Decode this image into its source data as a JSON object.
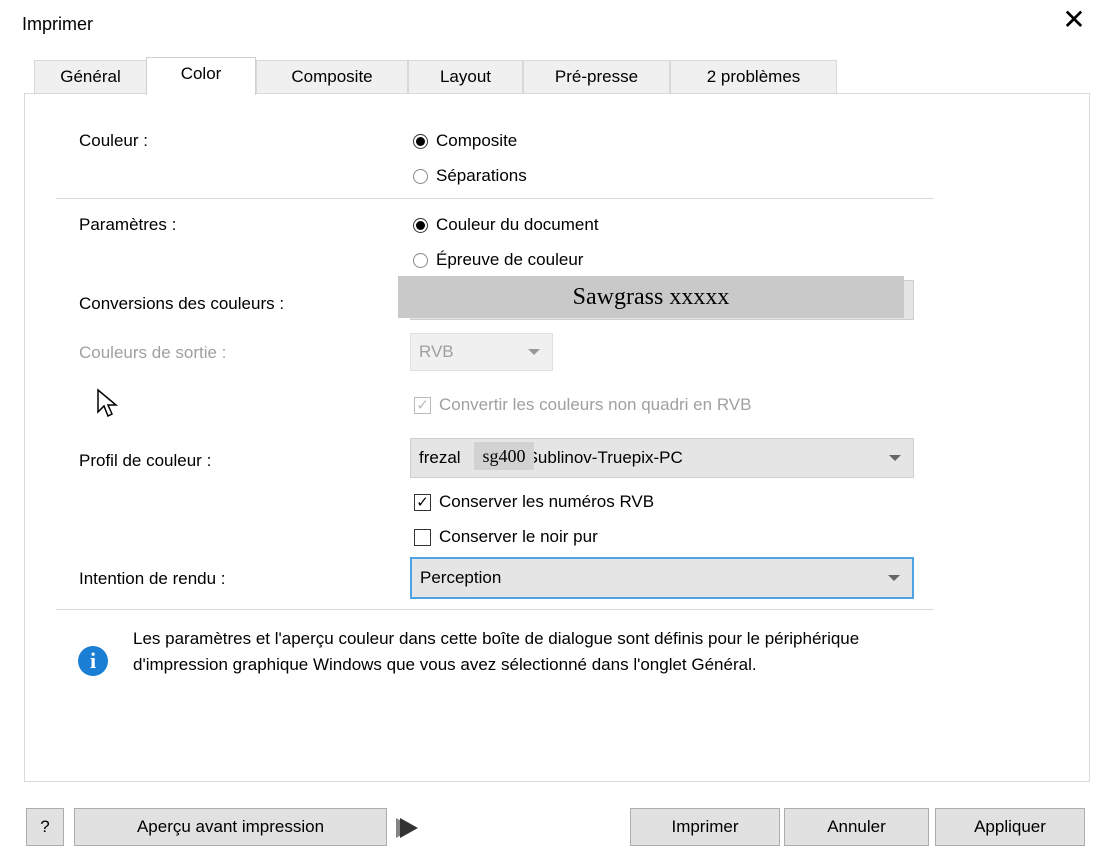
{
  "window": {
    "title": "Imprimer",
    "close_glyph": "✕"
  },
  "tabs": [
    "Général",
    "Color",
    "Composite",
    "Layout",
    "Pré-presse",
    "2 problèmes"
  ],
  "active_tab": "Color",
  "color": {
    "label": "Couleur :",
    "opt1": "Composite",
    "opt2": "Séparations",
    "selected": "Composite"
  },
  "params": {
    "label": "Paramètres :",
    "opt1": "Couleur du document",
    "opt2": "Épreuve de couleur",
    "selected": "Couleur du document"
  },
  "conversions": {
    "label": "Conversions des couleurs :",
    "overlay_text": "Sawgrass xxxxx"
  },
  "output_colors": {
    "label": "Couleurs de sortie :",
    "value": "RVB"
  },
  "convert_non_quadri": {
    "label": "Convertir les couleurs non quadri en RVB",
    "checked": true
  },
  "profile": {
    "label": "Profil de couleur :",
    "prefix": "frezal",
    "overlay_text": "sg400",
    "suffix": "Sublinov-Truepix-PC"
  },
  "keep_rgb": {
    "label": "Conserver les numéros RVB",
    "checked": true
  },
  "keep_black": {
    "label": "Conserver le noir pur",
    "checked": false
  },
  "rendering": {
    "label": "Intention de rendu :",
    "value": "Perception"
  },
  "info": {
    "icon": "info-icon",
    "text": "Les paramètres et l'aperçu couleur dans cette boîte de dialogue sont définis pour le périphérique d'impression graphique Windows que vous avez sélectionné dans l'onglet Général."
  },
  "buttons": {
    "help": "?",
    "preview": "Aperçu avant impression",
    "print": "Imprimer",
    "cancel": "Annuler",
    "apply": "Appliquer"
  },
  "colors": {
    "focus_border": "#4ca3e6",
    "info_blue": "#1a7fd4",
    "disabled_text": "#a0a0a0"
  }
}
